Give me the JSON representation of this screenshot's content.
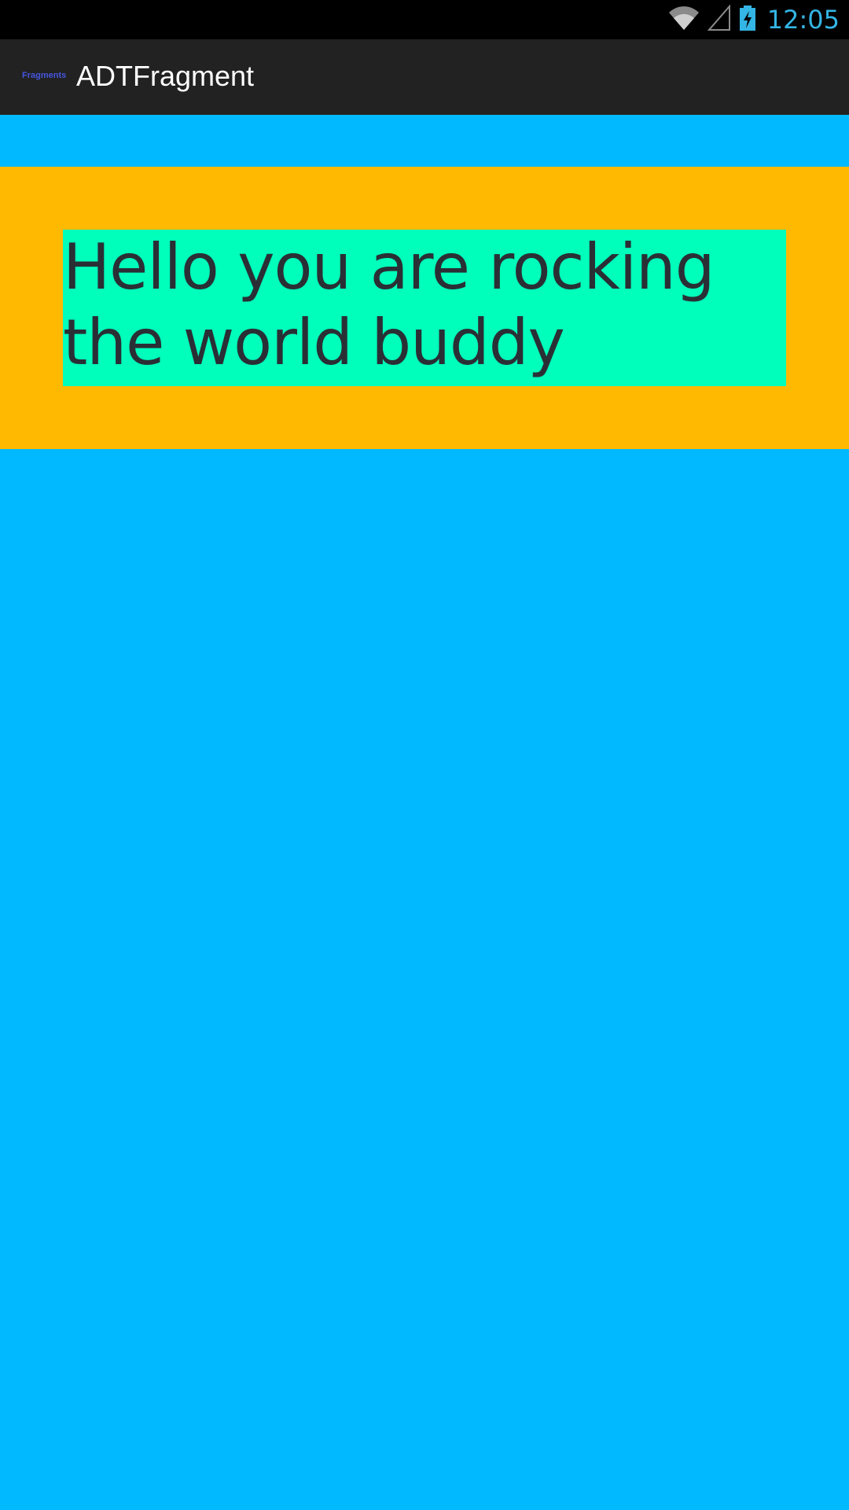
{
  "status_bar": {
    "time": "12:05",
    "icons": [
      "wifi-icon",
      "signal-icon",
      "battery-charging-icon"
    ]
  },
  "action_bar": {
    "app_icon_label": "Fragments",
    "title": "ADTFragment"
  },
  "fragment": {
    "message": "Hello you are rocking the world buddy"
  },
  "colors": {
    "background": "#00B9FF",
    "fragment_panel": "#FFB900",
    "message_box": "#00FFBB",
    "message_text": "#2A2F35",
    "clock": "#33B5E5"
  }
}
